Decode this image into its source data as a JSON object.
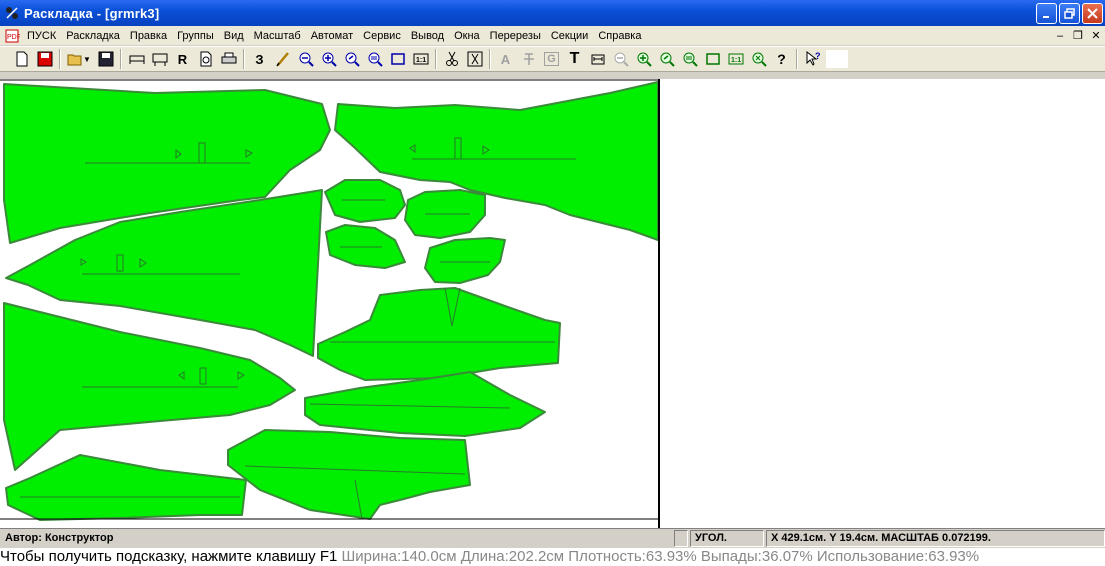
{
  "window": {
    "title": "Раскладка - [grmrk3]"
  },
  "menu": {
    "items": [
      "ПУСК",
      "Раскладка",
      "Правка",
      "Группы",
      "Вид",
      "Масштаб",
      "Автомат",
      "Сервис",
      "Вывод",
      "Окна",
      "Перерезы",
      "Секции",
      "Справка"
    ]
  },
  "toolbar": {
    "r_label": "R",
    "z_label": "З",
    "t_label": "T",
    "a_label": "A",
    "g_label": "G",
    "help_label": "?"
  },
  "status": {
    "author": "Автор: Конструктор",
    "mode": "УГОЛ.",
    "coords": "X 429.1см.  Y 19.4см. МАСШТАБ 0.072199."
  },
  "hint": {
    "text": "Чтобы получить подсказку, нажмите клавишу F1",
    "stats": "Ширина:140.0см Длина:202.2см Плотность:63.93% Выпады:36.07% Использование:63.93%"
  },
  "colors": {
    "piece_fill": "#00ee00",
    "piece_stroke": "#3a8a3a",
    "titlebar": "#0a50d8"
  }
}
